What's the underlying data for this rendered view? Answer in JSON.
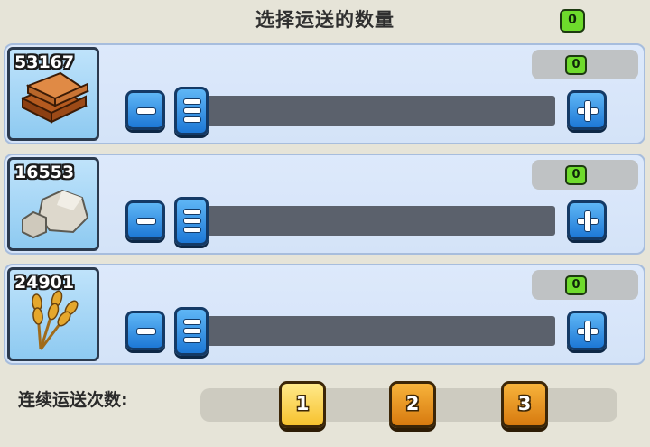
{
  "title": "选择运送的数量",
  "total_selected": "0",
  "resources": [
    {
      "icon": "wood-planks-icon",
      "count": "53167",
      "amount": "0"
    },
    {
      "icon": "stone-icon",
      "count": "16553",
      "amount": "0"
    },
    {
      "icon": "wheat-icon",
      "count": "24901",
      "amount": "0"
    }
  ],
  "footer": {
    "label": "连续运送次数:",
    "runs": [
      "1",
      "2",
      "3"
    ],
    "selected_run": "1"
  },
  "colors": {
    "panel": "#d4e3f8",
    "button_blue": "#1d78d6",
    "badge_green": "#6edb2c",
    "selected_gold": "#f7c22e",
    "option_orange": "#d77a0f"
  }
}
